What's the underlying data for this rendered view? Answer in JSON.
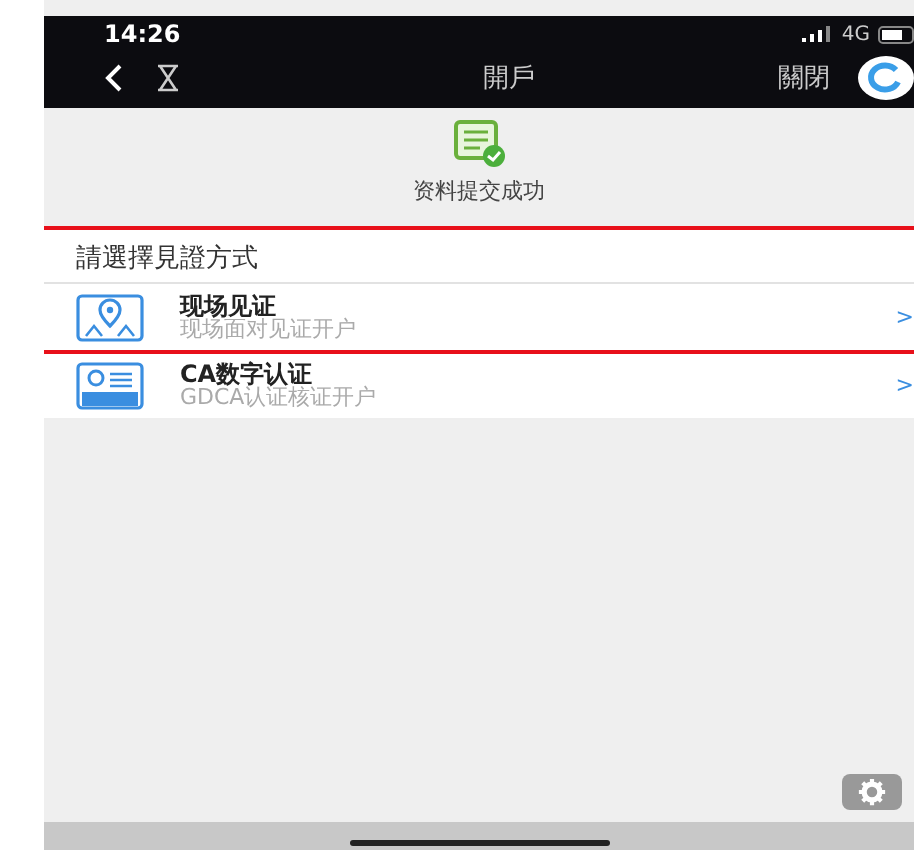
{
  "status_bar": {
    "time": "14:26",
    "network": "4G"
  },
  "nav_bar": {
    "title": "開戶",
    "close": "關閉"
  },
  "result": {
    "message": "资料提交成功"
  },
  "section": {
    "header": "請選擇見證方式",
    "items": [
      {
        "kind": "onsite",
        "title": "现场见证",
        "subtitle": "现场面对见证开户",
        "chevron": ">",
        "highlighted": true
      },
      {
        "kind": "ca",
        "title": "CA数字认证",
        "subtitle": "GDCA认证核证开户",
        "chevron": ">",
        "highlighted": false
      }
    ]
  }
}
